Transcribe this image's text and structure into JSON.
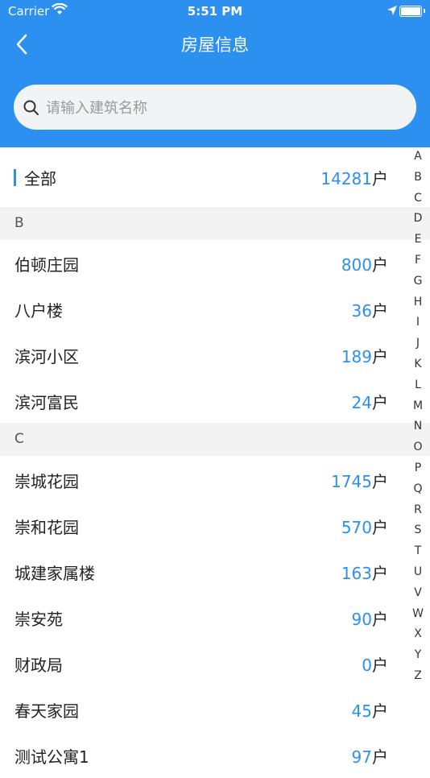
{
  "status": {
    "carrier": "Carrier",
    "time": "5:51 PM"
  },
  "nav": {
    "title": "房屋信息"
  },
  "search": {
    "placeholder": "请输入建筑名称"
  },
  "all": {
    "name": "全部",
    "count": "14281",
    "unit": "户"
  },
  "sections": [
    {
      "letter": "B",
      "items": [
        {
          "name": "伯顿庄园",
          "count": "800"
        },
        {
          "name": "八户楼",
          "count": "36"
        },
        {
          "name": "滨河小区",
          "count": "189"
        },
        {
          "name": "滨河富民",
          "count": "24"
        }
      ]
    },
    {
      "letter": "C",
      "items": [
        {
          "name": "崇城花园",
          "count": "1745"
        },
        {
          "name": "崇和花园",
          "count": "570"
        },
        {
          "name": "城建家属楼",
          "count": "163"
        },
        {
          "name": "崇安苑",
          "count": "90"
        },
        {
          "name": "财政局",
          "count": "0"
        },
        {
          "name": "春天家园",
          "count": "45"
        },
        {
          "name": "测试公寓1",
          "count": "97"
        }
      ]
    }
  ],
  "unit": "户",
  "index_letters": [
    "A",
    "B",
    "C",
    "D",
    "E",
    "F",
    "G",
    "H",
    "I",
    "J",
    "K",
    "L",
    "M",
    "N",
    "O",
    "P",
    "Q",
    "R",
    "S",
    "T",
    "U",
    "V",
    "W",
    "X",
    "Y",
    "Z"
  ],
  "colors": {
    "accent": "#2C90F0",
    "section_bg": "#F3F3F3"
  }
}
